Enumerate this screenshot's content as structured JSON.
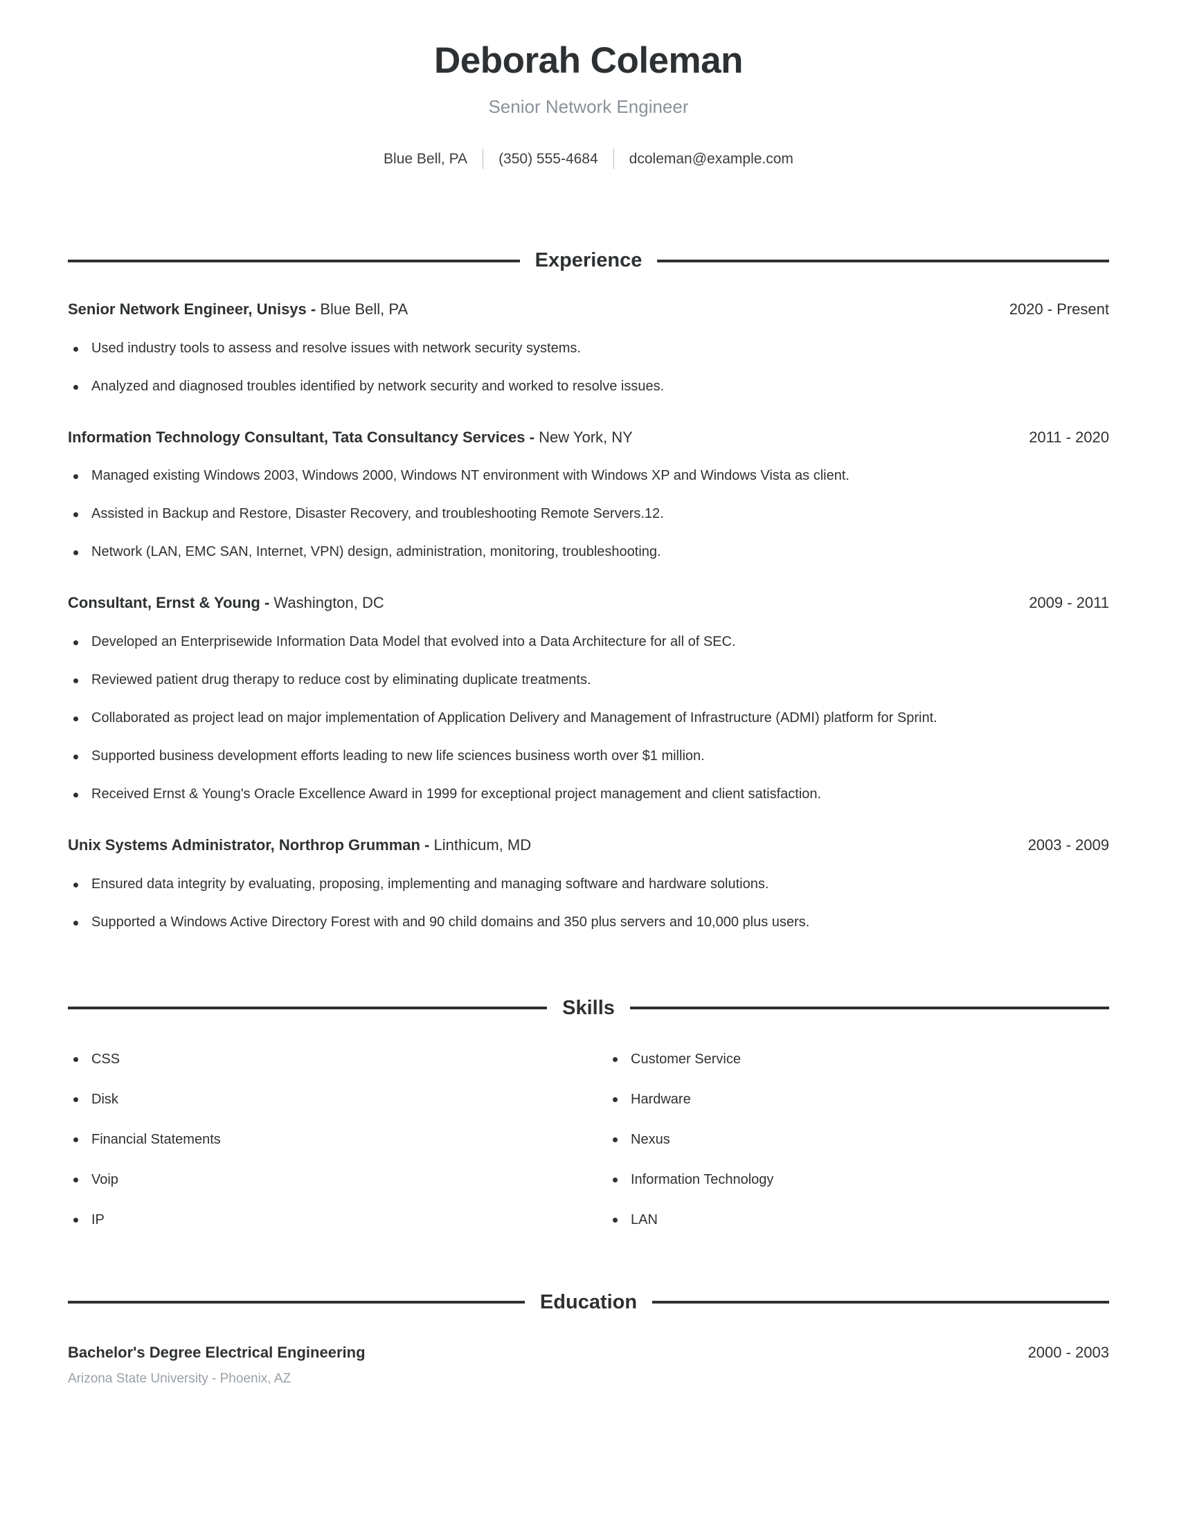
{
  "header": {
    "full_name": "Deborah Coleman",
    "headline": "Senior Network Engineer",
    "contact": {
      "location": "Blue Bell, PA",
      "phone": "(350) 555-4684",
      "email": "dcoleman@example.com"
    }
  },
  "sections": {
    "experience_title": "Experience",
    "skills_title": "Skills",
    "education_title": "Education"
  },
  "experience": [
    {
      "title_company": "Senior Network Engineer, Unisys -",
      "location": "Blue Bell, PA",
      "dates": "2020 - Present",
      "bullets": [
        "Used industry tools to assess and resolve issues with network security systems.",
        "Analyzed and diagnosed troubles identified by network security and worked to resolve issues."
      ]
    },
    {
      "title_company": "Information Technology Consultant, Tata Consultancy Services -",
      "location": "New York, NY",
      "dates": "2011 - 2020",
      "bullets": [
        "Managed existing Windows 2003, Windows 2000, Windows NT environment with Windows XP and Windows Vista as client.",
        "Assisted in Backup and Restore, Disaster Recovery, and troubleshooting Remote Servers.12.",
        "Network (LAN, EMC SAN, Internet, VPN) design, administration, monitoring, troubleshooting."
      ]
    },
    {
      "title_company": "Consultant, Ernst & Young -",
      "location": "Washington, DC",
      "dates": "2009 - 2011",
      "bullets": [
        "Developed an Enterprisewide Information Data Model that evolved into a Data Architecture for all of SEC.",
        "Reviewed patient drug therapy to reduce cost by eliminating duplicate treatments.",
        "Collaborated as project lead on major implementation of Application Delivery and Management of Infrastructure (ADMI) platform for Sprint.",
        "Supported business development efforts leading to new life sciences business worth over $1 million.",
        "Received Ernst & Young's Oracle Excellence Award in 1999 for exceptional project management and client satisfaction."
      ]
    },
    {
      "title_company": "Unix Systems Administrator, Northrop Grumman -",
      "location": "Linthicum, MD",
      "dates": "2003 - 2009",
      "bullets": [
        "Ensured data integrity by evaluating, proposing, implementing and managing software and hardware solutions.",
        "Supported a Windows Active Directory Forest with and 90 child domains and 350 plus servers and 10,000 plus users."
      ]
    }
  ],
  "skills": {
    "left_column": [
      "CSS",
      "Disk",
      "Financial Statements",
      "Voip",
      "IP"
    ],
    "right_column": [
      "Customer Service",
      "Hardware",
      "Nexus",
      "Information Technology",
      "LAN"
    ]
  },
  "education": [
    {
      "degree": "Bachelor's Degree Electrical Engineering",
      "school": "Arizona State University - Phoenix, AZ",
      "dates": "2000 - 2003"
    }
  ]
}
